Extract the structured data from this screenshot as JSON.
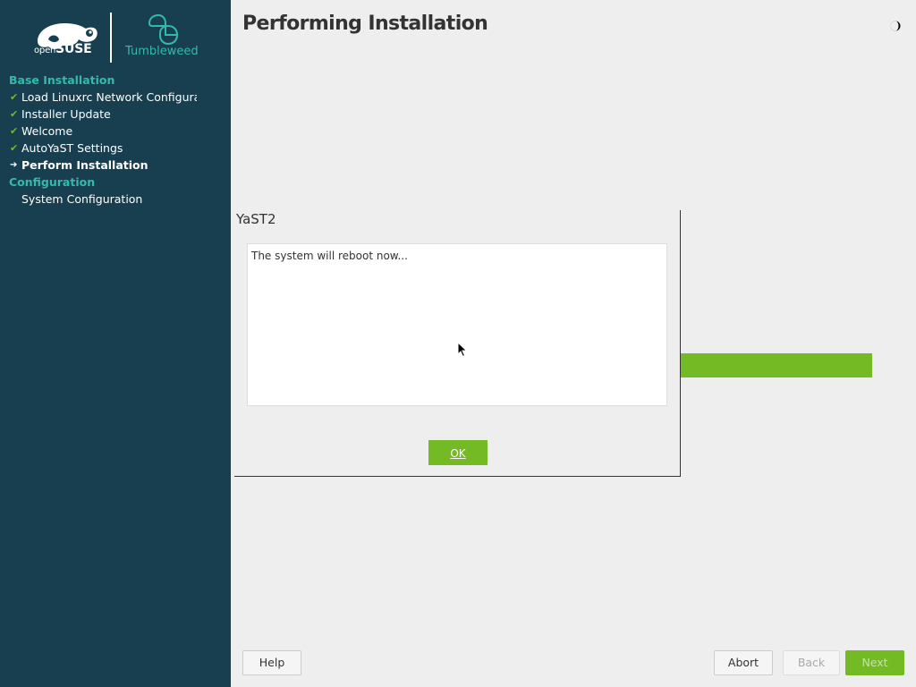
{
  "branding": {
    "opensuse_small": "open",
    "opensuse_big": "SUSE",
    "product": "Tumbleweed"
  },
  "sidebar": {
    "sections": [
      {
        "heading": "Base Installation",
        "steps": [
          {
            "label": "Load Linuxrc Network Configuration",
            "status": "done"
          },
          {
            "label": "Installer Update",
            "status": "done"
          },
          {
            "label": "Welcome",
            "status": "done"
          },
          {
            "label": "AutoYaST Settings",
            "status": "done"
          },
          {
            "label": "Perform Installation",
            "status": "current"
          }
        ]
      },
      {
        "heading": "Configuration",
        "steps": [
          {
            "label": "System Configuration",
            "status": "pending"
          }
        ]
      }
    ]
  },
  "main": {
    "title": "Performing Installation",
    "theme_icon": "half-moon-icon",
    "progress_fraction": 1.0
  },
  "dialog": {
    "title": "YaST2",
    "message": "The system will reboot now...",
    "ok_label": "OK"
  },
  "buttons": {
    "help": "Help",
    "abort": "Abort",
    "back": "Back",
    "next": "Next"
  },
  "colors": {
    "sidebar_bg": "#173f4f",
    "accent_green": "#73ba25",
    "heading_teal": "#35b9ab",
    "page_bg": "#eeeeee"
  }
}
